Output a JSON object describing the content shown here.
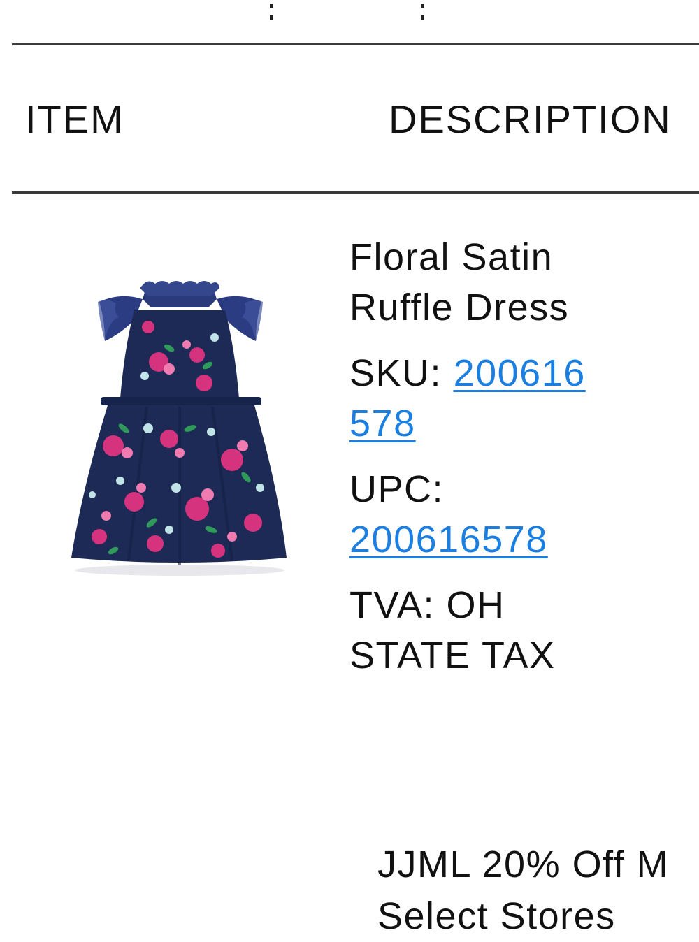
{
  "table": {
    "headers": {
      "item": "ITEM",
      "description": "DESCRIPTION"
    }
  },
  "product": {
    "name_line1": "Floral Satin",
    "name_line2": "Ruffle Dress",
    "sku_label": "SKU:",
    "sku_part1": "200616",
    "sku_part2": "578",
    "upc_label": "UPC:",
    "upc_value": "200616578",
    "tva_line1": "TVA: OH",
    "tva_line2": "STATE TAX",
    "image_icon": "dress-photo-icon"
  },
  "promo": {
    "line1": "JJML 20% Off M",
    "line2": "Select Stores"
  },
  "colors": {
    "link": "#1a7fe0",
    "rule": "#3a3a3a",
    "dress_navy": "#1c2a55",
    "flower_pink": "#d6337f"
  }
}
